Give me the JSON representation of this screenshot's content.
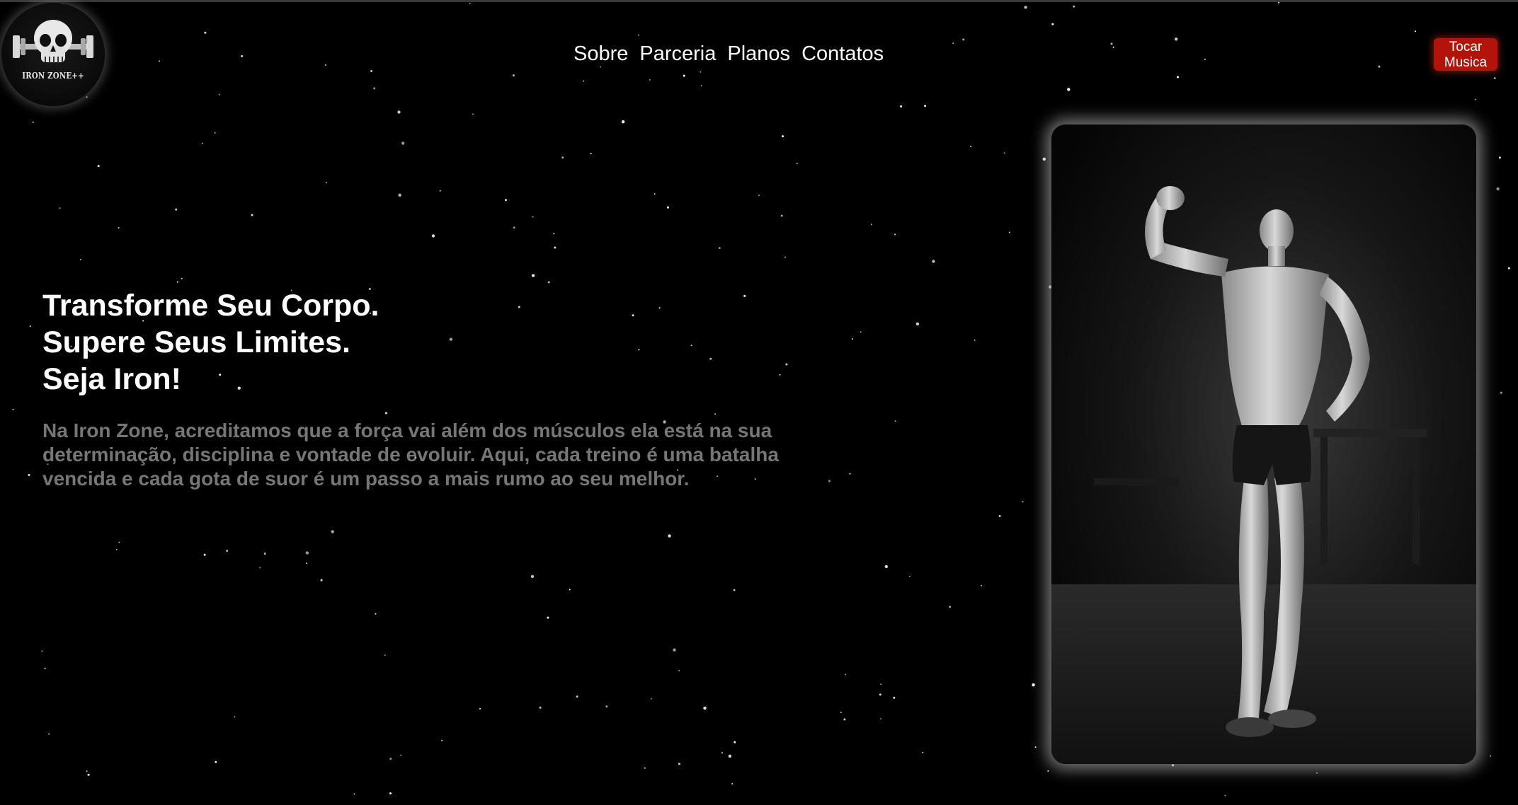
{
  "logo": {
    "text": "IRON ZONE++",
    "icon": "skull-dumbbell-icon"
  },
  "nav": {
    "items": [
      {
        "label": "Sobre"
      },
      {
        "label": "Parceria"
      },
      {
        "label": "Planos"
      },
      {
        "label": "Contatos"
      }
    ]
  },
  "music_button": {
    "line1": "Tocar",
    "line2": "Musica",
    "color": "#b3140a"
  },
  "hero": {
    "title_lines": [
      "Transforme Seu Corpo.",
      "Supere Seus Limites.",
      "Seja Iron!"
    ],
    "text": "Na Iron Zone, acreditamos que a força vai além dos músculos ela está na sua determinação, disciplina e vontade de evoluir. Aqui, cada treino é uma batalha vencida e cada gota de suor é um passo a mais rumo ao seu melhor."
  },
  "colors": {
    "background": "#000000",
    "text_primary": "#ffffff",
    "text_muted": "#767676",
    "accent": "#b3140a"
  }
}
